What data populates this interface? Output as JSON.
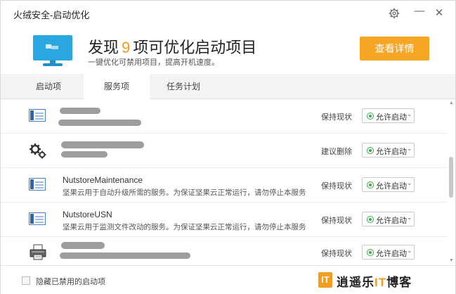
{
  "window": {
    "title": "火绒安全-启动优化",
    "controls": {
      "settings_icon": "gear-icon",
      "minimize": "—",
      "close": "✕"
    }
  },
  "header": {
    "headline_prefix": "发现",
    "count": "9",
    "headline_suffix": "项可优化启动项目",
    "subtitle": "一键优化可禁用项目，提高开机速度。",
    "detail_button": "查看详情",
    "accent_color": "#f7a525"
  },
  "tabs": [
    {
      "label": "启动项",
      "active": false
    },
    {
      "label": "服务项",
      "active": true
    },
    {
      "label": "任务计划",
      "active": false
    }
  ],
  "rows": [
    {
      "icon": "service-window-icon",
      "name": "",
      "description": "",
      "status": "保持现状",
      "action": "允许启动",
      "redacted": true
    },
    {
      "icon": "gears-icon",
      "name": "",
      "description": "",
      "status": "建议删除",
      "action": "允许启动",
      "redacted": true
    },
    {
      "icon": "service-window-icon",
      "name": "NutstoreMaintenance",
      "description": "坚果云用于自动升级所需的服务。为保证坚果云正常运行，请勿停止本服务",
      "status": "保持现状",
      "action": "允许启动",
      "redacted": false
    },
    {
      "icon": "service-window-icon",
      "name": "NutstoreUSN",
      "description": "坚果云用于监测文件改动的服务。为保证坚果云正常运行，请勿停止本服务",
      "status": "保持现状",
      "action": "允许启动",
      "redacted": false
    },
    {
      "icon": "printer-icon",
      "name": "",
      "description": "",
      "status": "保持现状",
      "action": "允许启动",
      "redacted": true
    }
  ],
  "footer": {
    "hide_disabled_label": "隐藏已禁用的启动项",
    "hide_disabled_checked": false
  },
  "watermark": {
    "logo": "IT",
    "text_a": "逍遥乐",
    "text_b": "IT",
    "text_c": "博客"
  }
}
